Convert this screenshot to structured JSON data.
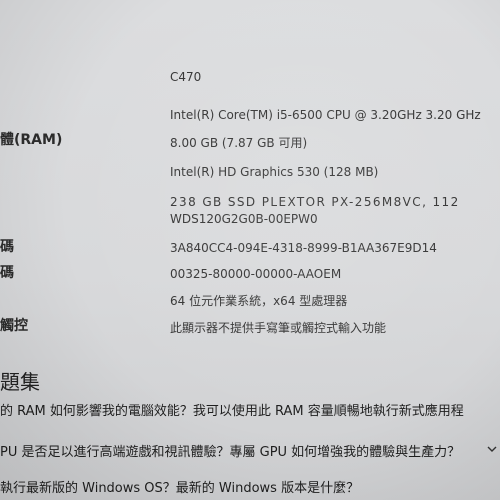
{
  "specs": [
    {
      "label": "",
      "value": "C470"
    },
    {
      "label": "",
      "value": "Intel(R) Core(TM) i5-6500 CPU @ 3.20GHz   3.20 GHz"
    },
    {
      "label": "體(RAM)",
      "value": "8.00 GB (7.87 GB 可用)"
    },
    {
      "label": "",
      "value": "Intel(R) HD Graphics 530 (128 MB)"
    },
    {
      "label": "",
      "value": "238 GB SSD PLEXTOR PX-256M8VC, 112"
    },
    {
      "label": "",
      "value": "WDS120G2G0B-00EPW0"
    },
    {
      "label": "碼",
      "value": "3A840CC4-094E-4318-8999-B1AA367E9D14"
    },
    {
      "label": "碼",
      "value": "00325-80000-00000-AAOEM"
    },
    {
      "label": "",
      "value": "64 位元作業系統，x64 型處理器"
    },
    {
      "label": "觸控",
      "value": "此顯示器不提供手寫筆或觸控式輸入功能"
    }
  ],
  "faq": {
    "title": "題集",
    "items": [
      "的 RAM 如何影響我的電腦效能？我可以使用此 RAM 容量順暢地執行新式應用程",
      "PU 是否足以進行高端遊戲和視訊體驗？專屬 GPU 如何增強我的體驗與生產力？",
      "執行最新版的 Windows OS？最新的 Windows 版本是什麼？"
    ]
  },
  "icons": {
    "faq_expand": "chevron-down-icon"
  }
}
